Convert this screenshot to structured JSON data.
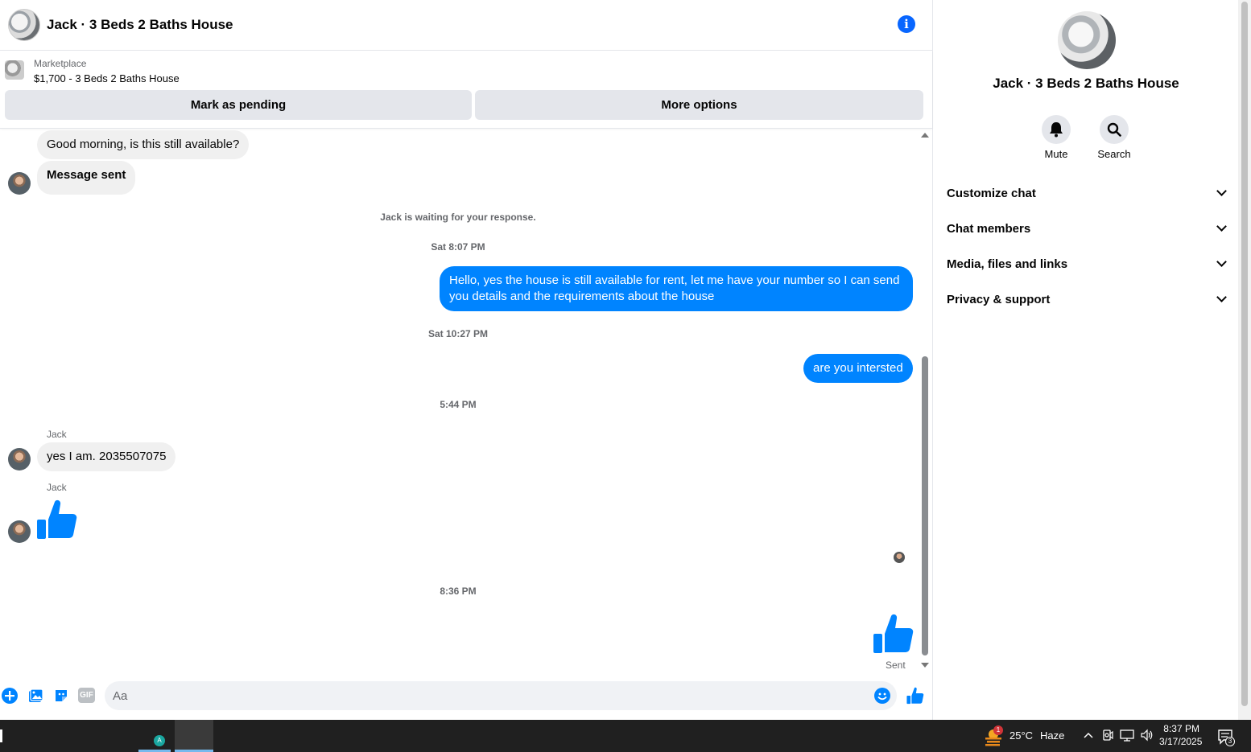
{
  "header": {
    "title": "Jack · 3 Beds 2 Baths House"
  },
  "marketplace": {
    "label": "Marketplace",
    "item": "$1,700 - 3 Beds 2 Baths House",
    "mark_pending": "Mark as pending",
    "more_options": "More options"
  },
  "messages": {
    "m1": "Good morning, is this still available?",
    "m2": "Message sent",
    "waiting": "Jack is waiting for your response.",
    "t1": "Sat 8:07 PM",
    "m3": "Hello, yes the house is still available for rent, let me have your number so I can send you details and the requirements about the house",
    "t2": "Sat 10:27 PM",
    "m4": "are you intersted",
    "t3": "5:44 PM",
    "sender1": "Jack",
    "m5": "yes I am. 2035507075",
    "sender2": "Jack",
    "t4": "8:36 PM",
    "sent": "Sent"
  },
  "composer": {
    "placeholder": "Aa",
    "gif_label": "GIF"
  },
  "right_panel": {
    "title": "Jack · 3 Beds 2 Baths House",
    "mute": "Mute",
    "search": "Search",
    "sections": [
      "Customize chat",
      "Chat members",
      "Media, files and links",
      "Privacy & support"
    ]
  },
  "taskbar": {
    "app_badge": "A",
    "weather_badge": "1",
    "temperature": "25°C",
    "condition": "Haze",
    "time": "8:37 PM",
    "date": "3/17/2025",
    "notifications": "3"
  },
  "colors": {
    "accent": "#0084ff",
    "bubble_in": "#f0f0f0",
    "button_bg": "#e4e6eb"
  }
}
